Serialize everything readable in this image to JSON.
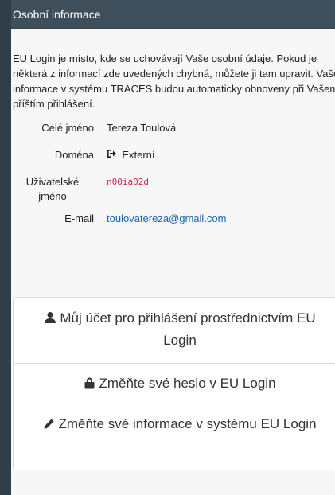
{
  "header": {
    "title": "Osobní informace"
  },
  "intro": "EU Login je místo, kde se uchovávají Vaše osobní údaje. Pokud je některá z informací zde uvedených chybná, můžete ji tam upravit. Vaše informace v systému TRACES budou automaticky obnoveny při Vašem příštím přihlášení.",
  "profile": {
    "full_name_label": "Celé jméno",
    "full_name": "Tereza Toulová",
    "domain_label": "Doména",
    "domain_icon": "sign-in-icon",
    "domain": "Externí",
    "username_label": "Uživatelské jméno",
    "username": "n00ia02d",
    "email_label": "E-mail",
    "email": "toulovatereza@gmail.com"
  },
  "actions": {
    "account": {
      "icon": "user-icon",
      "label": "Můj účet pro přihlášení prostřednictvím EU Login"
    },
    "password": {
      "icon": "lock-icon",
      "label": "Změňte své heslo v EU Login"
    },
    "edit": {
      "icon": "pencil-icon",
      "label": "Změňte své informace v systému EU Login"
    }
  }
}
